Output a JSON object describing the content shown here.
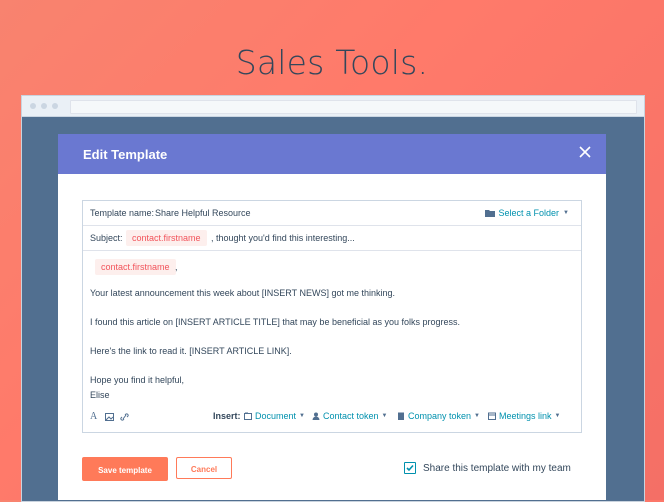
{
  "headline": "Sales Tools.",
  "modal": {
    "title": "Edit Template",
    "template_name_label": "Template name:",
    "template_name_value": "Share Helpful Resource",
    "select_folder": "Select a Folder",
    "subject_label": "Subject:",
    "subject_token": "contact.firstname",
    "subject_rest": ", thought you'd find this interesting...",
    "greeting_token": "contact.firstname",
    "greeting_punct": ",",
    "body": [
      "Your latest announcement this week about [INSERT NEWS] got me thinking.",
      "I found this article on [INSERT ARTICLE TITLE] that may be beneficial as you folks progress.",
      "Here's the link to read it. [INSERT ARTICLE LINK].",
      "Hope you find it helpful,",
      "Elise"
    ],
    "insert_label": "Insert:",
    "insert_items": [
      "Document",
      "Contact token",
      "Company token",
      "Meetings link"
    ],
    "save_button": "Save template",
    "cancel_button": "Cancel",
    "share_label": "Share this template with my team",
    "share_checked": true
  },
  "colors": {
    "header": "#6a78d1",
    "accent": "#ff7a59",
    "link": "#0091ae",
    "text": "#33475b"
  }
}
